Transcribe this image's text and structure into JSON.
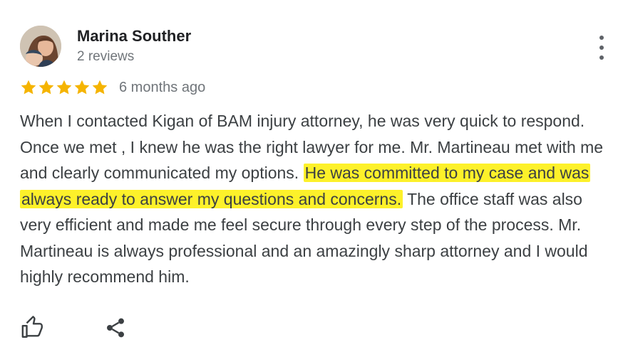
{
  "review": {
    "author": "Marina Souther",
    "author_reviews": "2 reviews",
    "rating": 5,
    "rating_max": 5,
    "time": "6 months ago",
    "text_before": "When I contacted Kigan of BAM injury attorney, he was very quick to respond. Once we met , I knew he was the right lawyer for me. Mr. Martineau met with me and clearly communicated my options. ",
    "text_highlight": "He was committed to my case and was always ready to answer my questions and concerns.",
    "text_after": " The office staff was also very efficient and made me feel secure through every step of the process. Mr. Martineau is always professional and an amazingly sharp attorney and I would highly recommend him."
  },
  "colors": {
    "star": "#f5b400",
    "highlight": "#fdf12a",
    "icon": "#5f6368"
  },
  "icons": {
    "more": "more-vertical-icon",
    "like": "thumbs-up-icon",
    "share": "share-icon"
  }
}
